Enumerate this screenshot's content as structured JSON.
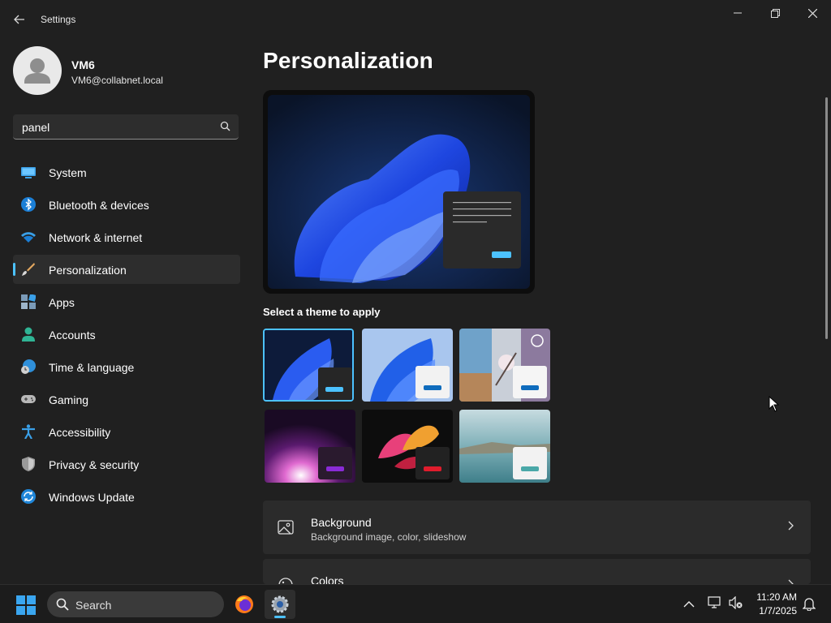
{
  "window": {
    "title": "Settings"
  },
  "user": {
    "name": "VM6",
    "email": "VM6@collabnet.local"
  },
  "search": {
    "value": "panel"
  },
  "nav": {
    "items": [
      {
        "label": "System",
        "icon": "monitor-icon"
      },
      {
        "label": "Bluetooth & devices",
        "icon": "bluetooth-icon"
      },
      {
        "label": "Network & internet",
        "icon": "wifi-icon"
      },
      {
        "label": "Personalization",
        "icon": "brush-icon",
        "selected": true
      },
      {
        "label": "Apps",
        "icon": "apps-icon"
      },
      {
        "label": "Accounts",
        "icon": "person-icon"
      },
      {
        "label": "Time & language",
        "icon": "globe-clock-icon"
      },
      {
        "label": "Gaming",
        "icon": "gamepad-icon"
      },
      {
        "label": "Accessibility",
        "icon": "accessibility-icon"
      },
      {
        "label": "Privacy & security",
        "icon": "shield-icon"
      },
      {
        "label": "Windows Update",
        "icon": "update-icon"
      }
    ]
  },
  "main": {
    "title": "Personalization",
    "themes_label": "Select a theme to apply",
    "themes": [
      {
        "name": "windows-dark",
        "selected": true
      },
      {
        "name": "windows-light"
      },
      {
        "name": "spotlight"
      },
      {
        "name": "glow"
      },
      {
        "name": "captured-motion"
      },
      {
        "name": "flow"
      }
    ],
    "cards": [
      {
        "title": "Background",
        "description": "Background image, color, slideshow",
        "icon": "image-icon"
      },
      {
        "title": "Colors",
        "description": "",
        "icon": "palette-icon"
      }
    ]
  },
  "taskbar": {
    "search_label": "Search",
    "time": "11:20 AM",
    "date": "1/7/2025"
  },
  "colors": {
    "accent": "#4cc2ff",
    "background": "#202020",
    "card": "#2b2b2b"
  }
}
